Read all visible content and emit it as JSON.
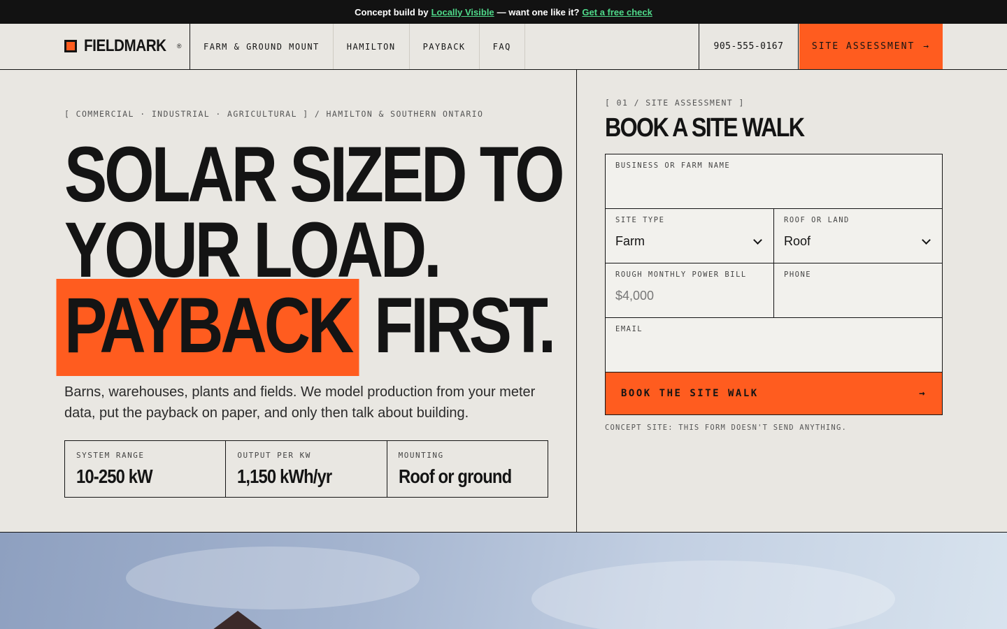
{
  "topbar": {
    "prefix": "Concept build by",
    "brand_link": "Locally Visible",
    "middle": "— want one like it?",
    "cta_link": "Get a free check"
  },
  "header": {
    "logo": "FIELDMARK",
    "logo_mark": "®",
    "nav": [
      "FARM & GROUND MOUNT",
      "HAMILTON",
      "PAYBACK",
      "FAQ"
    ],
    "phone": "905-555-0167",
    "cta_label": "SITE ASSESSMENT",
    "cta_arrow": "→"
  },
  "hero": {
    "eyebrow": "[ COMMERCIAL · INDUSTRIAL · AGRICULTURAL ] / HAMILTON & SOUTHERN ONTARIO",
    "line1": "SOLAR SIZED TO",
    "line2": "YOUR LOAD.",
    "line3_highlight": "PAYBACK",
    "line3_rest": "FIRST.",
    "subtitle": "Barns, warehouses, plants and fields. We model production from your meter data, put the payback on paper, and only then talk about building.",
    "stats": [
      {
        "label": "SYSTEM RANGE",
        "value": "10-250 kW"
      },
      {
        "label": "OUTPUT PER KW",
        "value": "1,150 kWh/yr"
      },
      {
        "label": "MOUNTING",
        "value": "Roof or ground"
      }
    ]
  },
  "panel": {
    "eyebrow": "[ 01 / SITE ASSESSMENT ]",
    "title": "BOOK A SITE WALK",
    "fields": {
      "business": {
        "label": "BUSINESS OR FARM NAME",
        "value": ""
      },
      "site_type": {
        "label": "SITE TYPE",
        "value": "Farm"
      },
      "roof_land": {
        "label": "ROOF OR LAND",
        "value": "Roof"
      },
      "bill": {
        "label": "ROUGH MONTHLY POWER BILL",
        "placeholder": "$4,000"
      },
      "phone": {
        "label": "PHONE",
        "value": ""
      },
      "email": {
        "label": "EMAIL",
        "value": ""
      }
    },
    "submit_label": "BOOK THE SITE WALK",
    "submit_arrow": "→",
    "note": "CONCEPT SITE: THIS FORM DOESN'T SEND ANYTHING."
  },
  "colors": {
    "accent": "#ff5c1f",
    "ink": "#141414",
    "paper": "#e9e7e2",
    "link_green": "#4fd98a"
  }
}
